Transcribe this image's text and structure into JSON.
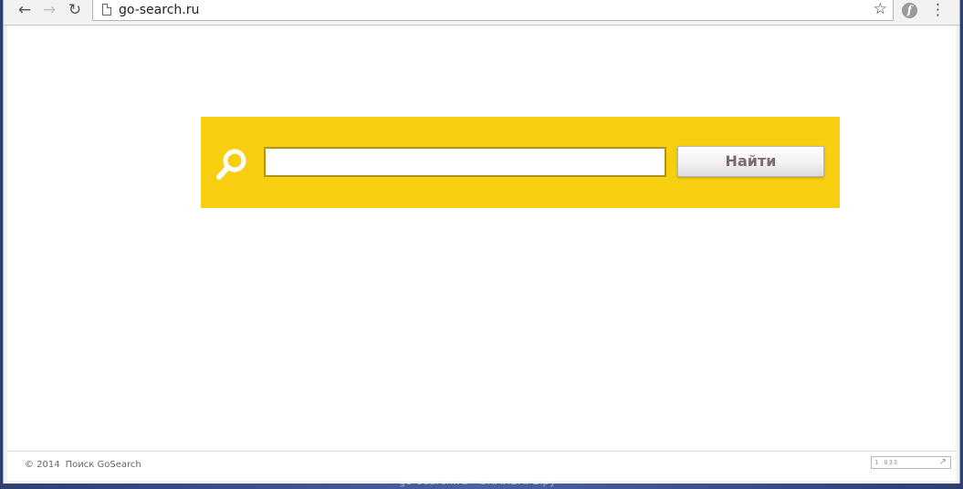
{
  "toolbar": {
    "back_icon": "arrow-left-icon",
    "back_glyph": "←",
    "forward_icon": "arrow-right-icon",
    "forward_glyph": "→",
    "reload_icon": "reload-icon",
    "reload_glyph": "↻",
    "url": "go-search.ru",
    "bookmark_glyph": "☆",
    "extension_glyph": "f",
    "menu_glyph": "⋮"
  },
  "search": {
    "input_value": "",
    "input_placeholder": "",
    "button_label": "Найти",
    "panel_color": "#f7cf10"
  },
  "footer": {
    "copyright": "© 2014",
    "brand": "Поиск GoSearch",
    "counter_value": "1 033"
  },
  "watermark": {
    "text": "go-search.ru - СПАЙВАРЕ.ру"
  }
}
